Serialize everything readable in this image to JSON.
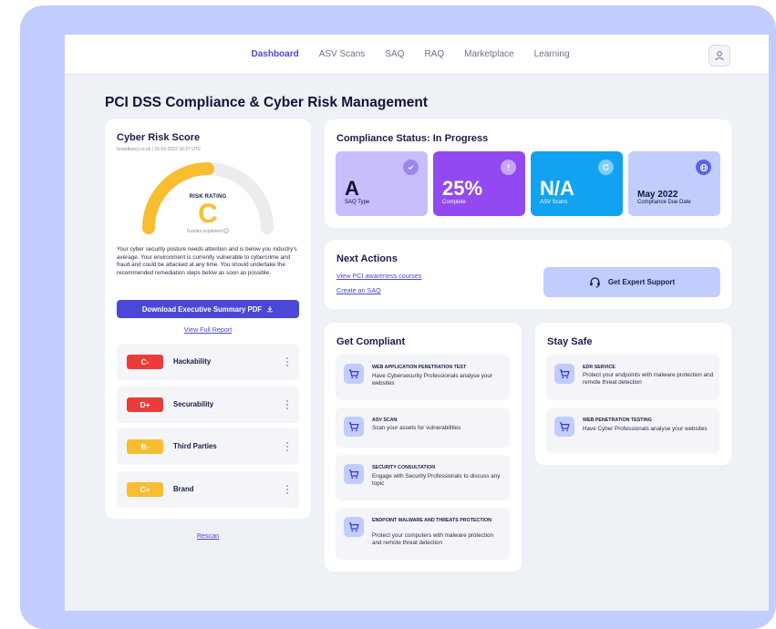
{
  "nav": {
    "links": [
      "Dashboard",
      "ASV Scans",
      "SAQ",
      "RAQ",
      "Marketplace",
      "Learning"
    ],
    "active_index": 0
  },
  "page": {
    "title": "PCI DSS Compliance & Cyber Risk Management"
  },
  "risk": {
    "title": "Cyber Risk Score",
    "meta": "broadberry.co.uk | 25-02-2022 16:27 UTC",
    "rating_label": "RISK RATING",
    "grade": "C",
    "grades_explained": "Grades explained",
    "gauge_fraction": 0.5,
    "description": "Your cyber security posture needs attention and is below you industry's average. Your environment is currently vulnerable to cybercrime and fraud and could be attacked at any time. You should undertake the recommended remediation steps below as soon as possible.",
    "download_label": "Download Executive Summary PDF",
    "full_report_label": "View Full Report",
    "metrics": [
      {
        "grade": "C-",
        "name": "Hackability",
        "color": "#ec3b3b"
      },
      {
        "grade": "D+",
        "name": "Securability",
        "color": "#ec3b3b"
      },
      {
        "grade": "B-",
        "name": "Third Parties",
        "color": "#f8bd31"
      },
      {
        "grade": "C+",
        "name": "Brand",
        "color": "#f8bd31"
      }
    ],
    "rescan_label": "Rescan"
  },
  "compliance": {
    "title": "Compliance Status: In Progress",
    "tiles": [
      {
        "value": "A",
        "label": "SAQ Type",
        "icon": "check-icon"
      },
      {
        "value": "25%",
        "label": "Complete",
        "icon": "exclamation-icon"
      },
      {
        "value": "N/A",
        "label": "ASV Scans",
        "icon": "refresh-icon"
      },
      {
        "value": "May 2022",
        "label": "Compliance Due Date",
        "icon": "globe-icon"
      }
    ]
  },
  "next_actions": {
    "title": "Next Actions",
    "links": [
      "View PCI awareness courses",
      "Create an SAQ"
    ],
    "support_label": "Get Expert Support"
  },
  "get_compliant": {
    "title": "Get Compliant",
    "items": [
      {
        "title": "WEB APPLICATION PENETRATION TEST",
        "desc": "Have Cybersecurity Professionals analyse your websites"
      },
      {
        "title": "ASV SCAN",
        "desc": "Scan your assets for vulnerabilities"
      },
      {
        "title": "SECURITY CONSULTATION",
        "desc": "Engage with Security Professionals to discuss any topic"
      },
      {
        "title": "ENDPOINT MALWARE AND THREATS PROTECTION",
        "desc": "Protect your computers with malware protection and remote threat detection"
      }
    ]
  },
  "stay_safe": {
    "title": "Stay Safe",
    "items": [
      {
        "title": "EDR SERVICE",
        "desc": "Protect your endpoints with malware protection and remote threat detection"
      },
      {
        "title": "WEB PENETRATION TESTING",
        "desc": "Have Cyber Professionals analyse your websites"
      }
    ]
  },
  "colors": {
    "brand": "#4b48d8",
    "tile_saq": "#c8bdfd",
    "tile_complete": "#9249f1",
    "tile_asv": "#11a3f2",
    "tile_due": "#c0cdfd",
    "gauge": "#f8bd31",
    "danger": "#ec3b3b"
  }
}
